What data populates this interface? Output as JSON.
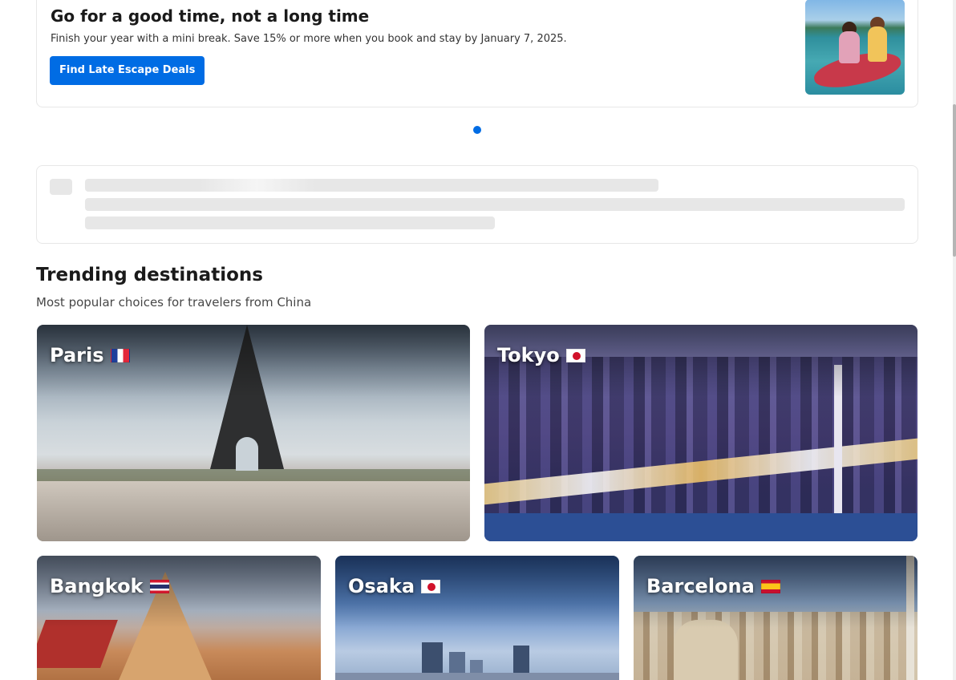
{
  "promo": {
    "title": "Go for a good time, not a long time",
    "subtitle": "Finish your year with a mini break. Save 15% or more when you book and stay by January 7, 2025.",
    "button_label": "Find Late Escape Deals",
    "image_icon": "kayak-photo"
  },
  "carousel": {
    "active_index": 0,
    "count": 1
  },
  "trending": {
    "title": "Trending destinations",
    "subtitle": "Most popular choices for travelers from China",
    "destinations": [
      {
        "name": "Paris",
        "flag": "france-flag-icon"
      },
      {
        "name": "Tokyo",
        "flag": "japan-flag-icon"
      },
      {
        "name": "Bangkok",
        "flag": "thailand-flag-icon"
      },
      {
        "name": "Osaka",
        "flag": "japan-flag-icon"
      },
      {
        "name": "Barcelona",
        "flag": "spain-flag-icon"
      }
    ]
  },
  "colors": {
    "primary": "#006ce4",
    "border": "#e7e7e7",
    "skeleton": "#e7e7e7"
  }
}
